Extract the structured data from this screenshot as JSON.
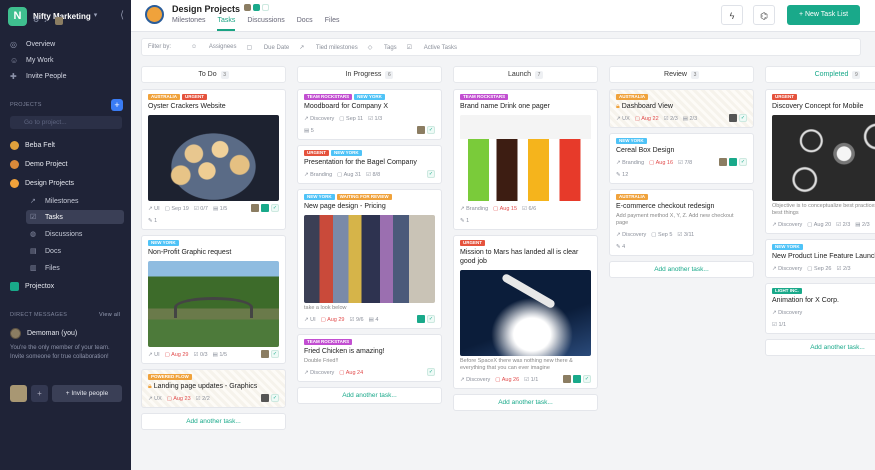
{
  "workspace": {
    "name": "Nifty Marketing",
    "logo_letter": "N"
  },
  "sidebar": {
    "nav": [
      {
        "icon": "overview-icon",
        "label": "Overview"
      },
      {
        "icon": "user-icon",
        "label": "My Work"
      },
      {
        "icon": "invite-icon",
        "label": "Invite People"
      }
    ],
    "projects_heading": "PROJECTS",
    "goto_placeholder": "Go to project...",
    "projects": [
      {
        "label": "Beba Felt",
        "color": "#e0a13c"
      },
      {
        "label": "Demo Project",
        "color": "#d9893a"
      },
      {
        "label": "Design Projects",
        "color": "#f0a23b"
      }
    ],
    "subs": [
      {
        "icon": "milestones-icon",
        "label": "Milestones"
      },
      {
        "icon": "tasks-icon",
        "label": "Tasks"
      },
      {
        "icon": "discussions-icon",
        "label": "Discussions"
      },
      {
        "icon": "docs-icon",
        "label": "Docs"
      },
      {
        "icon": "files-icon",
        "label": "Files"
      }
    ],
    "projectox": "Projectox",
    "dm_heading": "DIRECT MESSAGES",
    "view_all": "View all",
    "dm_user": "Demoman (you)",
    "dm_text": "You're the only member of your team. Invite someone for true collaboration!",
    "invite_button": "+ Invite people"
  },
  "header": {
    "title": "Design Projects",
    "tabs": [
      "Milestones",
      "Tasks",
      "Discussions",
      "Docs",
      "Files"
    ],
    "new_list_button": "+ New Task List"
  },
  "filters": {
    "label": "Filter by:",
    "items": [
      "Assignees",
      "Due Date",
      "Tied milestones",
      "Tags",
      "Active Tasks"
    ]
  },
  "columns": [
    {
      "title": "To Do",
      "count": "3",
      "add": "Add another task..."
    },
    {
      "title": "In Progress",
      "count": "6",
      "add": "Add another task..."
    },
    {
      "title": "Launch",
      "count": "7",
      "add": "Add another task..."
    },
    {
      "title": "Review",
      "count": "3",
      "add": "Add another task..."
    },
    {
      "title": "Completed",
      "count": "9",
      "add": "Add another task..."
    }
  ],
  "cards": {
    "todo1": {
      "tags": [
        "AUSTRALIA",
        "URGENT"
      ],
      "title": "Oyster Crackers Website",
      "meta": [
        "UI",
        "Sep 19",
        "0/7",
        "1/5",
        "1"
      ]
    },
    "todo2": {
      "tags": [
        "NEW YORK"
      ],
      "title": "Non-Profit Graphic request",
      "meta": [
        "UI",
        "Aug 29",
        "0/3",
        "1/5"
      ]
    },
    "todo3": {
      "tags": [
        "POWERED FLOW"
      ],
      "title": "Landing page updates - Graphics",
      "meta": [
        "UX",
        "Aug 23",
        "2/2"
      ]
    },
    "prog1": {
      "tags": [
        "TEAM ROCKSTARS",
        "NEW YORK"
      ],
      "title": "Moodboard for Company X",
      "meta": [
        "Discovery",
        "Sep 11",
        "1/3",
        "5"
      ]
    },
    "prog2": {
      "tags": [
        "URGENT",
        "NEW YORK"
      ],
      "title": "Presentation for the Bagel Company",
      "meta": [
        "Branding",
        "Aug 31",
        "8/8"
      ]
    },
    "prog3": {
      "tags": [
        "NEW YORK",
        "WAITING FOR REVIEW"
      ],
      "title": "New page design - Pricing",
      "desc": "take a look below",
      "meta": [
        "UI",
        "Aug 29",
        "9/6",
        "4"
      ]
    },
    "prog4": {
      "tags": [
        "TEAM ROCKSTARS"
      ],
      "title": "Fried Chicken is amazing!",
      "desc": "Double Fried!!",
      "meta": [
        "Discovery",
        "Aug 24"
      ]
    },
    "launch1": {
      "tags": [
        "TEAM ROCKSTARS"
      ],
      "title": "Brand name Drink one pager",
      "meta": [
        "Branding",
        "Aug 15",
        "6/6",
        "1"
      ]
    },
    "launch2": {
      "tags": [
        "URGENT"
      ],
      "title": "Mission to Mars has landed all is clear good job",
      "desc": "Before SpaceX there was nothing new there & everything that you can ever imagine",
      "meta": [
        "Discovery",
        "Aug 26",
        "1/1"
      ]
    },
    "rev1": {
      "tags": [
        "AUSTRALIA"
      ],
      "title": "Dashboard View",
      "meta": [
        "UX",
        "Aug 22",
        "2/3",
        "2/3"
      ]
    },
    "rev2": {
      "tags": [
        "NEW YORK"
      ],
      "title": "Cereal Box Design",
      "meta": [
        "Branding",
        "Aug 16",
        "7/8",
        "12"
      ]
    },
    "rev3": {
      "tags": [
        "AUSTRALIA"
      ],
      "title": "E-commerce checkout redesign",
      "desc": "Add payment method X, Y, Z. Add new checkout page",
      "meta": [
        "Discovery",
        "Sep 5",
        "3/11",
        "4"
      ]
    },
    "comp1": {
      "tags": [
        "URGENT"
      ],
      "title": "Discovery Concept for Mobile",
      "desc": "Objective is to conceptualize best practices are the best things",
      "meta": [
        "Discovery",
        "Aug 20",
        "2/3",
        "2/3"
      ]
    },
    "comp2": {
      "tags": [
        "NEW YORK"
      ],
      "title": "New Product Line Feature Launch",
      "meta": [
        "Discovery",
        "Sep 26",
        "2/3"
      ]
    },
    "comp3": {
      "tags": [
        "LIGHT INC."
      ],
      "title": "Animation for X Corp.",
      "meta": [
        "Discovery",
        "1/1"
      ]
    }
  },
  "tag_colors": {
    "AUSTRALIA": "#f0a23b",
    "URGENT": "#e5533d",
    "NEW YORK": "#4fc3f7",
    "POWERED FLOW": "#f0a23b",
    "TEAM ROCKSTARS": "#c24fd1",
    "WAITING FOR REVIEW": "#f0a23b",
    "LIGHT INC.": "#19a98a"
  }
}
